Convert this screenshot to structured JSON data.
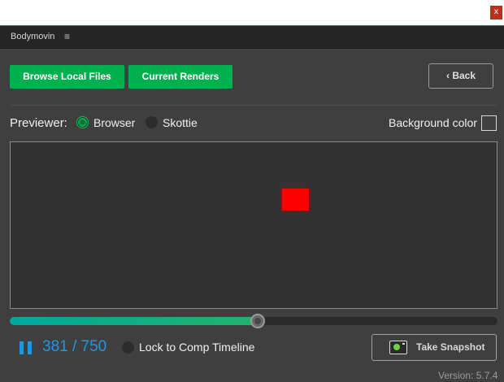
{
  "window": {
    "close_glyph": "x",
    "close_icon": "close-icon"
  },
  "panel": {
    "title": "Bodymovin",
    "menu_icon": "hamburger-menu-icon",
    "menu_glyph": "≡"
  },
  "toolbar": {
    "browse_label": "Browse Local Files",
    "renders_label": "Current Renders",
    "back_label": "‹ Back"
  },
  "previewer": {
    "label": "Previewer:",
    "options": [
      {
        "label": "Browser",
        "selected": true
      },
      {
        "label": "Skottie",
        "selected": false
      }
    ],
    "background_label": "Background color",
    "background_color": "#3f3f3f"
  },
  "stage": {
    "shape_color": "#ff0000"
  },
  "timeline": {
    "current_frame": 381,
    "total_frames": 750,
    "frame_text": "381 / 750",
    "progress": 0.508,
    "play_state_icon": "pause-icon"
  },
  "footer": {
    "lock_label": "Lock to Comp Timeline",
    "lock_checked": false,
    "snapshot_label": "Take Snapshot",
    "snapshot_icon": "camera-icon",
    "version": "Version: 5.7.4"
  },
  "colors": {
    "accent_green": "#00b050",
    "accent_blue": "#1f97e0",
    "panel_bg": "#3f3f3f"
  }
}
